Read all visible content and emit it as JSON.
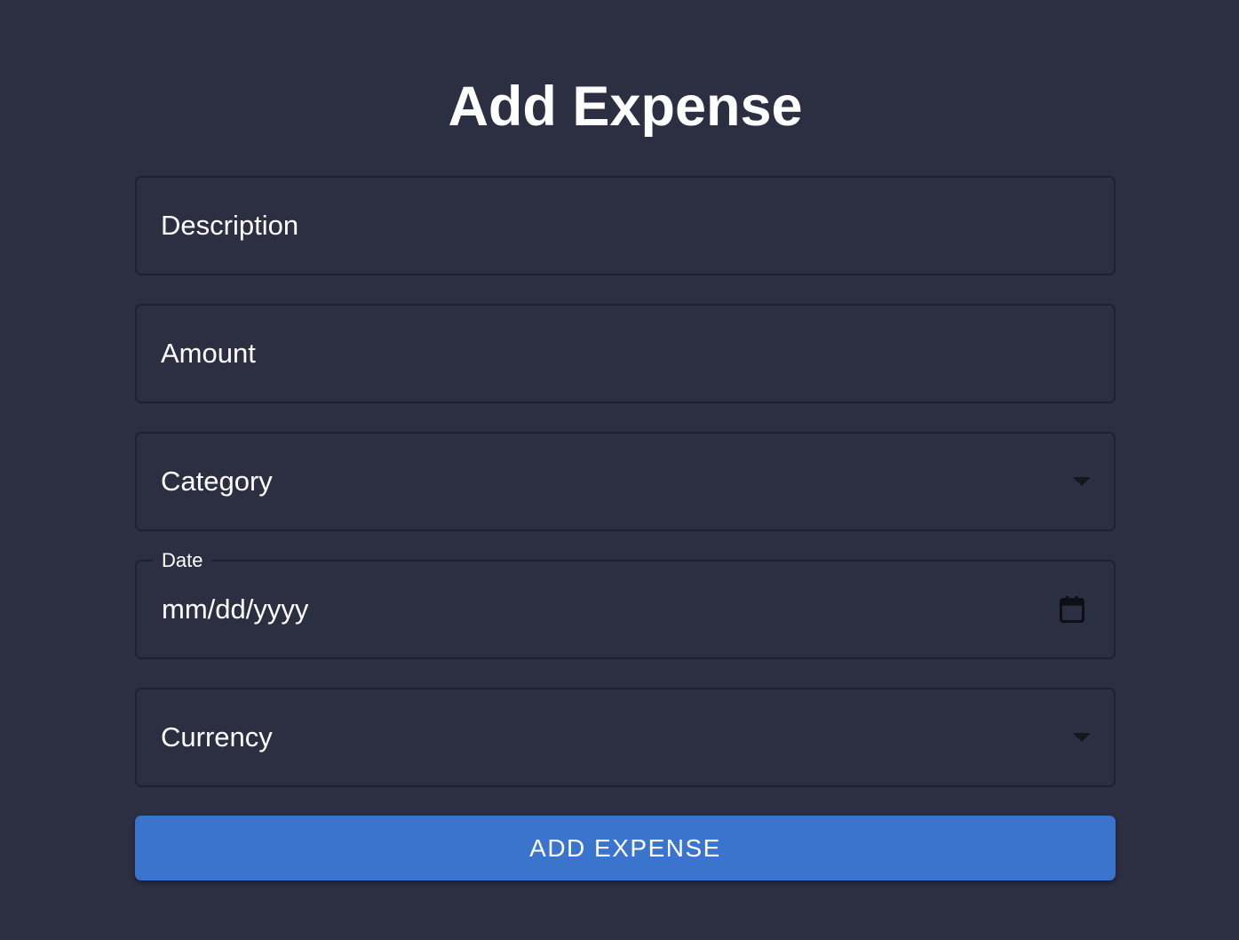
{
  "page": {
    "title": "Add Expense"
  },
  "form": {
    "description": {
      "placeholder": "Description",
      "value": ""
    },
    "amount": {
      "placeholder": "Amount",
      "value": ""
    },
    "category": {
      "placeholder": "Category",
      "selected": ""
    },
    "date": {
      "label": "Date",
      "value": "mm/dd/yyyy",
      "icon": "calendar-icon"
    },
    "currency": {
      "placeholder": "Currency",
      "selected": ""
    },
    "submit_label": "ADD EXPENSE"
  },
  "colors": {
    "background": "#2c2e42",
    "field_border": "#1f2131",
    "text": "#ffffff",
    "button": "#3a74cd"
  }
}
